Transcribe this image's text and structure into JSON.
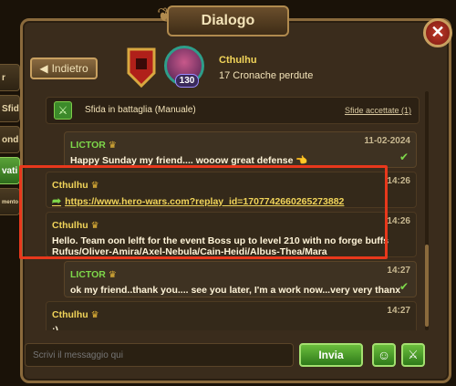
{
  "window": {
    "title": "Dialogo"
  },
  "sidebar": {
    "tabs": [
      {
        "label": "r"
      },
      {
        "label": "Sfida"
      },
      {
        "label": "ondi"
      },
      {
        "label": "vati"
      },
      {
        "label": "mento"
      }
    ]
  },
  "header": {
    "back_label": "Indietro",
    "avatar_level": "130",
    "player_name": "Cthulhu",
    "guild_name": "17 Cronache perdute"
  },
  "system_row": {
    "text": "Sfida in battaglia (Manuale)",
    "link": "Sfide accettate (1)"
  },
  "messages": [
    {
      "author": "LICTOR",
      "time": "11-02-2024",
      "text": "Happy Sunday my friend.... wooow great defense 👈"
    },
    {
      "author": "Cthulhu",
      "time": "14:26",
      "text": "https://www.hero-wars.com?replay_id=1707742660265273882"
    },
    {
      "author": "Cthulhu",
      "time": "14:26",
      "text": "Hello. Team oon lelft for the event Boss up to level 210 with no forge buffs",
      "text2": "Rufus/Oliver-Amira/Axel-Nebula/Cain-Heidi/Albus-Thea/Mara"
    },
    {
      "author": "LICTOR",
      "time": "14:27",
      "text": "ok my friend..thank you.... see you later, I'm a work now...very very thanx"
    },
    {
      "author": "Cthulhu",
      "time": "14:27",
      "text": ":)"
    }
  ],
  "composer": {
    "placeholder": "Scrivi il messaggio qui",
    "send_label": "Invia"
  },
  "colors": {
    "highlight": "#e8381c",
    "own_name": "#f2d55a",
    "other_name": "#7ed84a"
  }
}
